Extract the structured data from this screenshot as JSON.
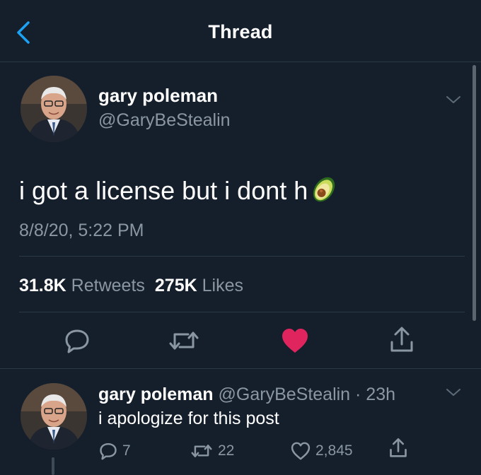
{
  "nav": {
    "title": "Thread",
    "back_icon": "chevron-left-icon"
  },
  "colors": {
    "background": "#151f2c",
    "secondary_text": "#8a97a3",
    "accent": "#1da1f2",
    "like": "#e0245e",
    "divider": "#2c3947"
  },
  "tweet": {
    "author_name": "gary poleman",
    "author_handle": "@GaryBeStealin",
    "text": "i got a license but i dont h",
    "emoji": "avocado",
    "timestamp": "8/8/20, 5:22 PM",
    "retweet_count": "31.8K",
    "retweets_label": "Retweets",
    "like_count": "275K",
    "likes_label": "Likes",
    "liked": true,
    "actions": [
      "reply-icon",
      "retweet-icon",
      "heart-icon",
      "share-icon"
    ]
  },
  "reply": {
    "author_name": "gary poleman",
    "meta": "@GaryBeStealin · 23h",
    "text": "i apologize for this post",
    "reply_count": "7",
    "retweet_count": "22",
    "like_count": "2,845"
  }
}
